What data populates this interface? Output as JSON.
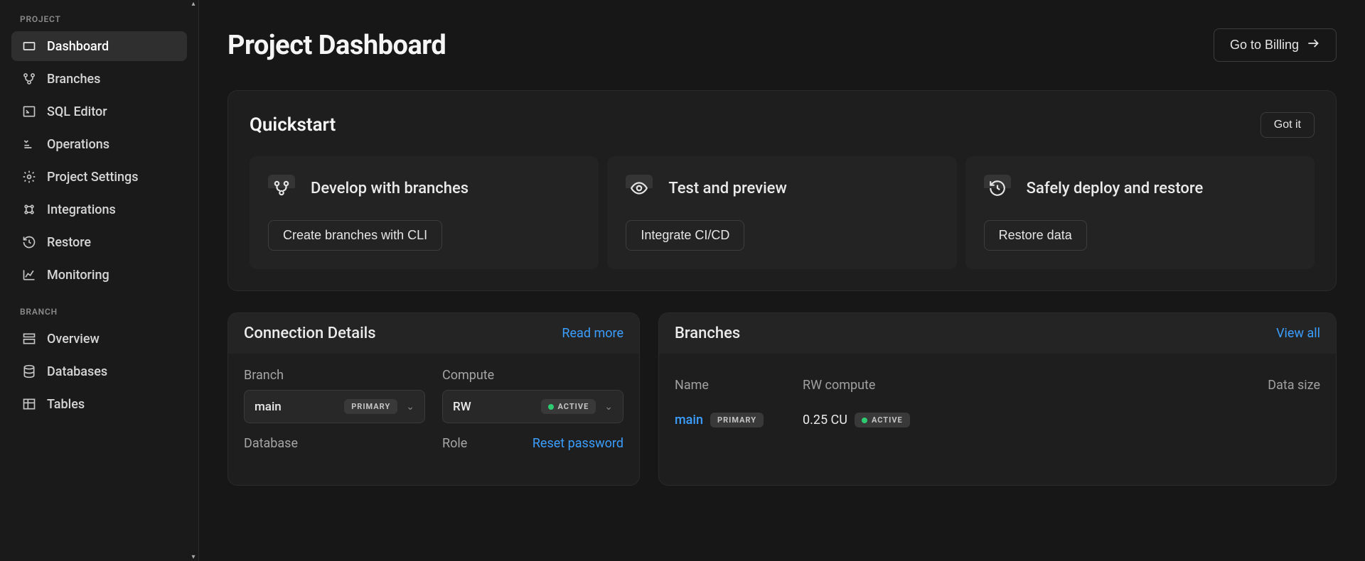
{
  "sidebar": {
    "sections": {
      "project_label": "PROJECT",
      "branch_label": "BRANCH"
    },
    "project_items": [
      {
        "label": "Dashboard",
        "icon": "dashboard"
      },
      {
        "label": "Branches",
        "icon": "branches"
      },
      {
        "label": "SQL Editor",
        "icon": "sql"
      },
      {
        "label": "Operations",
        "icon": "operations"
      },
      {
        "label": "Project Settings",
        "icon": "settings"
      },
      {
        "label": "Integrations",
        "icon": "integrations"
      },
      {
        "label": "Restore",
        "icon": "restore"
      },
      {
        "label": "Monitoring",
        "icon": "monitoring"
      }
    ],
    "branch_items": [
      {
        "label": "Overview",
        "icon": "overview"
      },
      {
        "label": "Databases",
        "icon": "databases"
      },
      {
        "label": "Tables",
        "icon": "tables"
      }
    ]
  },
  "header": {
    "title": "Project Dashboard",
    "billing_button": "Go to Billing"
  },
  "quickstart": {
    "title": "Quickstart",
    "dismiss": "Got it",
    "cards": [
      {
        "title": "Develop with branches",
        "button": "Create branches with CLI",
        "icon": "branches"
      },
      {
        "title": "Test and preview",
        "button": "Integrate CI/CD",
        "icon": "preview"
      },
      {
        "title": "Safely deploy and restore",
        "button": "Restore data",
        "icon": "restore"
      }
    ]
  },
  "connection_details": {
    "title": "Connection Details",
    "read_more": "Read more",
    "branch_label": "Branch",
    "branch_value": "main",
    "branch_badge": "PRIMARY",
    "compute_label": "Compute",
    "compute_value": "RW",
    "compute_badge": "ACTIVE",
    "database_label": "Database",
    "role_label": "Role",
    "reset_password": "Reset password"
  },
  "branches_panel": {
    "title": "Branches",
    "view_all": "View all",
    "columns": {
      "name": "Name",
      "rw": "RW compute",
      "size": "Data size"
    },
    "rows": [
      {
        "name": "main",
        "badge": "PRIMARY",
        "compute": "0.25 CU",
        "status": "ACTIVE"
      }
    ]
  }
}
